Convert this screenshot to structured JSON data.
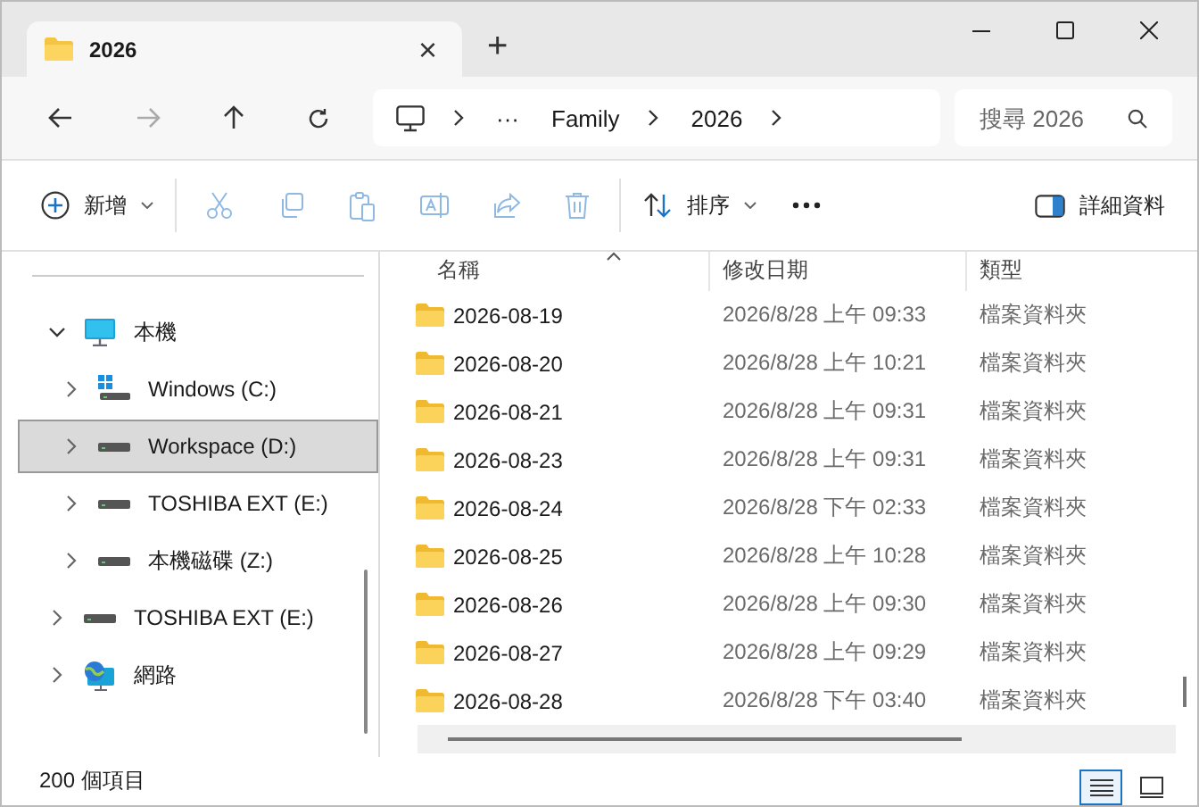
{
  "tab": {
    "title": "2026",
    "close": "×",
    "new": "+"
  },
  "address": {
    "ellipsis": "···",
    "crumbs": [
      "Family",
      "2026"
    ]
  },
  "search": {
    "placeholder": "搜尋 2026"
  },
  "toolbar": [
    {
      "kind": "new",
      "label": "新增",
      "disabled": false
    },
    {
      "kind": "cut",
      "disabled": true
    },
    {
      "kind": "copy",
      "disabled": true
    },
    {
      "kind": "paste",
      "disabled": true
    },
    {
      "kind": "rename",
      "disabled": true
    },
    {
      "kind": "share",
      "disabled": true
    },
    {
      "kind": "delete",
      "disabled": true
    },
    {
      "kind": "sort",
      "label": "排序",
      "disabled": false
    },
    {
      "kind": "more",
      "disabled": false
    },
    {
      "kind": "details",
      "label": "詳細資料",
      "disabled": false
    }
  ],
  "sidebar": {
    "items": [
      {
        "kind": "pc",
        "label": "本機",
        "expanded": true,
        "selected": false,
        "children": [
          {
            "kind": "windrive",
            "label": "Windows (C:)",
            "expanded": false,
            "selected": false
          },
          {
            "kind": "drive",
            "label": "Workspace (D:)",
            "expanded": false,
            "selected": true
          },
          {
            "kind": "drive",
            "label": "TOSHIBA EXT (E:)",
            "expanded": false,
            "selected": false
          },
          {
            "kind": "drive",
            "label": "本機磁碟 (Z:)",
            "expanded": false,
            "selected": false
          }
        ]
      },
      {
        "kind": "drive",
        "label": "TOSHIBA EXT (E:)",
        "expanded": false,
        "selected": false
      },
      {
        "kind": "network",
        "label": "網路",
        "expanded": false,
        "selected": false
      }
    ]
  },
  "table": {
    "columns": [
      "名稱",
      "修改日期",
      "類型"
    ],
    "rows": [
      [
        "2026-08-19",
        "2026/8/28 上午 09:33",
        "檔案資料夾"
      ],
      [
        "2026-08-20",
        "2026/8/28 上午 10:21",
        "檔案資料夾"
      ],
      [
        "2026-08-21",
        "2026/8/28 上午 09:31",
        "檔案資料夾"
      ],
      [
        "2026-08-23",
        "2026/8/28 上午 09:31",
        "檔案資料夾"
      ],
      [
        "2026-08-24",
        "2026/8/28 下午 02:33",
        "檔案資料夾"
      ],
      [
        "2026-08-25",
        "2026/8/28 上午 10:28",
        "檔案資料夾"
      ],
      [
        "2026-08-26",
        "2026/8/28 上午 09:30",
        "檔案資料夾"
      ],
      [
        "2026-08-27",
        "2026/8/28 上午 09:29",
        "檔案資料夾"
      ],
      [
        "2026-08-28",
        "2026/8/28 下午 03:40",
        "檔案資料夾"
      ]
    ]
  },
  "status_bar": {
    "count": "200 個項目",
    "views": [
      {
        "kind": "details",
        "selected": true
      },
      {
        "kind": "tiles",
        "selected": false
      }
    ]
  }
}
